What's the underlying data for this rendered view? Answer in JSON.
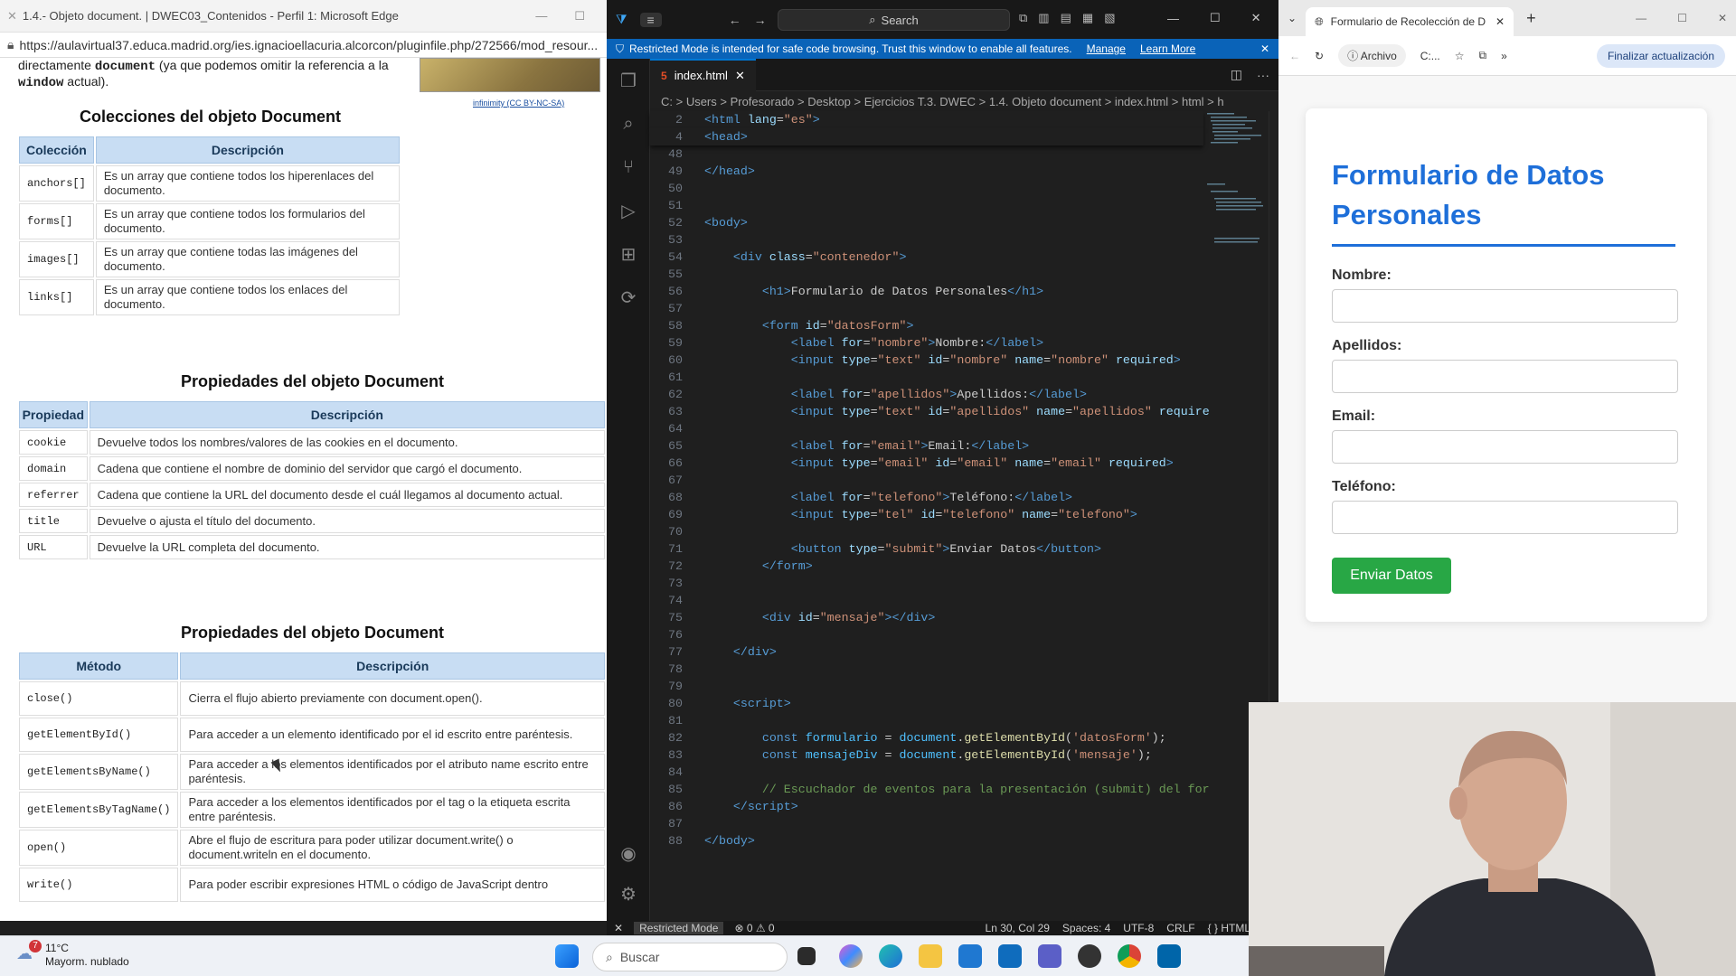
{
  "edge_left": {
    "title": "1.4.- Objeto document. | DWEC03_Contenidos - Perfil 1: Microsoft Edge",
    "url": "https://aulavirtual37.educa.madrid.org/ies.ignacioellacuria.alcorcon/pluginfile.php/272566/mod_resour...",
    "intro_pre": "directamente ",
    "intro_code1": "document",
    "intro_mid": " (ya que podemos omitir la referencia a la ",
    "intro_code2": "window",
    "intro_post": " actual).",
    "image_credit_author": "infinimity",
    "image_credit_license": "(CC BY-NC-SA)",
    "section1_title": "Colecciones del objeto Document",
    "table1": {
      "headers": [
        "Colección",
        "Descripción"
      ],
      "rows": [
        [
          "anchors[]",
          "Es un array que contiene todos los hiperenlaces del documento."
        ],
        [
          "forms[]",
          "Es un array que contiene todos los formularios del documento."
        ],
        [
          "images[]",
          "Es un array que contiene todas las imágenes del documento."
        ],
        [
          "links[]",
          "Es un array que contiene todos los enlaces del documento."
        ]
      ]
    },
    "section2_title": "Propiedades del objeto Document",
    "table2": {
      "headers": [
        "Propiedad",
        "Descripción"
      ],
      "rows": [
        [
          "cookie",
          "Devuelve todos los nombres/valores de las cookies en el documento."
        ],
        [
          "domain",
          "Cadena que contiene el nombre de dominio del servidor que cargó el documento."
        ],
        [
          "referrer",
          "Cadena que contiene la URL del documento desde el cuál llegamos al documento actual."
        ],
        [
          "title",
          "Devuelve o ajusta el título del documento."
        ],
        [
          "URL",
          "Devuelve la URL completa del documento."
        ]
      ]
    },
    "section3_title": "Propiedades del objeto Document",
    "table3": {
      "headers": [
        "Método",
        "Descripción"
      ],
      "rows": [
        [
          "close()",
          "Cierra el flujo abierto previamente con document.open()."
        ],
        [
          "getElementById()",
          "Para acceder a un elemento identificado por el id escrito entre paréntesis."
        ],
        [
          "getElementsByName()",
          "Para acceder a los elementos identificados por el atributo name escrito entre paréntesis."
        ],
        [
          "getElementsByTagName()",
          "Para acceder a los elementos identificados por el tag o la etiqueta escrita entre paréntesis."
        ],
        [
          "open()",
          "Abre el flujo de escritura para poder utilizar document.write() o document.writeln en el documento."
        ],
        [
          "write()",
          "Para poder escribir expresiones HTML o código de JavaScript dentro"
        ]
      ]
    }
  },
  "vscode": {
    "search_placeholder": "Search",
    "restricted_msg": "Restricted Mode is intended for safe code browsing. Trust this window to enable all features.",
    "manage": "Manage",
    "learn_more": "Learn More",
    "tab": "index.html",
    "breadcrumb": "C: > Users > Profesorado > Desktop > Ejercicios T.3. DWEC > 1.4. Objeto document > index.html > html > h",
    "code_lines": [
      {
        "n": "2",
        "h": "<span class=tg>&lt;html</span> <span class=at>lang</span>=<span class=st>\"es\"</span><span class=tg>&gt;</span>",
        "sticky": true
      },
      {
        "n": "4",
        "h": "<span class=tg>&lt;head&gt;</span>",
        "sticky": true
      },
      {
        "n": "48",
        "h": ""
      },
      {
        "n": "49",
        "h": "<span class=tg>&lt;/head&gt;</span>"
      },
      {
        "n": "50",
        "h": ""
      },
      {
        "n": "51",
        "h": ""
      },
      {
        "n": "52",
        "h": "<span class=tg>&lt;body&gt;</span>"
      },
      {
        "n": "53",
        "h": ""
      },
      {
        "n": "54",
        "h": "    <span class=tg>&lt;div</span> <span class=at>class</span>=<span class=st>\"contenedor\"</span><span class=tg>&gt;</span>"
      },
      {
        "n": "55",
        "h": ""
      },
      {
        "n": "56",
        "h": "        <span class=tg>&lt;h1&gt;</span>Formulario de Datos Personales<span class=tg>&lt;/h1&gt;</span>"
      },
      {
        "n": "57",
        "h": ""
      },
      {
        "n": "58",
        "h": "        <span class=tg>&lt;form</span> <span class=at>id</span>=<span class=st>\"datosForm\"</span><span class=tg>&gt;</span>"
      },
      {
        "n": "59",
        "h": "            <span class=tg>&lt;label</span> <span class=at>for</span>=<span class=st>\"nombre\"</span><span class=tg>&gt;</span>Nombre:<span class=tg>&lt;/label&gt;</span>"
      },
      {
        "n": "60",
        "h": "            <span class=tg>&lt;input</span> <span class=at>type</span>=<span class=st>\"text\"</span> <span class=at>id</span>=<span class=st>\"nombre\"</span> <span class=at>name</span>=<span class=st>\"nombre\"</span> <span class=at>required</span><span class=tg>&gt;</span>"
      },
      {
        "n": "61",
        "h": ""
      },
      {
        "n": "62",
        "h": "            <span class=tg>&lt;label</span> <span class=at>for</span>=<span class=st>\"apellidos\"</span><span class=tg>&gt;</span>Apellidos:<span class=tg>&lt;/label&gt;</span>"
      },
      {
        "n": "63",
        "h": "            <span class=tg>&lt;input</span> <span class=at>type</span>=<span class=st>\"text\"</span> <span class=at>id</span>=<span class=st>\"apellidos\"</span> <span class=at>name</span>=<span class=st>\"apellidos\"</span> <span class=at>require</span>"
      },
      {
        "n": "64",
        "h": ""
      },
      {
        "n": "65",
        "h": "            <span class=tg>&lt;label</span> <span class=at>for</span>=<span class=st>\"email\"</span><span class=tg>&gt;</span>Email:<span class=tg>&lt;/label&gt;</span>"
      },
      {
        "n": "66",
        "h": "            <span class=tg>&lt;input</span> <span class=at>type</span>=<span class=st>\"email\"</span> <span class=at>id</span>=<span class=st>\"email\"</span> <span class=at>name</span>=<span class=st>\"email\"</span> <span class=at>required</span><span class=tg>&gt;</span>"
      },
      {
        "n": "67",
        "h": ""
      },
      {
        "n": "68",
        "h": "            <span class=tg>&lt;label</span> <span class=at>for</span>=<span class=st>\"telefono\"</span><span class=tg>&gt;</span>Teléfono:<span class=tg>&lt;/label&gt;</span>"
      },
      {
        "n": "69",
        "h": "            <span class=tg>&lt;input</span> <span class=at>type</span>=<span class=st>\"tel\"</span> <span class=at>id</span>=<span class=st>\"telefono\"</span> <span class=at>name</span>=<span class=st>\"telefono\"</span><span class=tg>&gt;</span>"
      },
      {
        "n": "70",
        "h": ""
      },
      {
        "n": "71",
        "h": "            <span class=tg>&lt;button</span> <span class=at>type</span>=<span class=st>\"submit\"</span><span class=tg>&gt;</span>Enviar Datos<span class=tg>&lt;/button&gt;</span>"
      },
      {
        "n": "72",
        "h": "        <span class=tg>&lt;/form&gt;</span>"
      },
      {
        "n": "73",
        "h": ""
      },
      {
        "n": "74",
        "h": ""
      },
      {
        "n": "75",
        "h": "        <span class=tg>&lt;div</span> <span class=at>id</span>=<span class=st>\"mensaje\"</span><span class=tg>&gt;&lt;/div&gt;</span>"
      },
      {
        "n": "76",
        "h": ""
      },
      {
        "n": "77",
        "h": "    <span class=tg>&lt;/div&gt;</span>"
      },
      {
        "n": "78",
        "h": ""
      },
      {
        "n": "79",
        "h": ""
      },
      {
        "n": "80",
        "h": "    <span class=tg>&lt;script&gt;</span>"
      },
      {
        "n": "81",
        "h": ""
      },
      {
        "n": "82",
        "h": "        <span class=kw>const</span> <span class=vr>formulario</span> = <span class=vr>document</span>.<span class=fn>getElementById</span>(<span class=st>'datosForm'</span>);"
      },
      {
        "n": "83",
        "h": "        <span class=kw>const</span> <span class=vr>mensajeDiv</span> = <span class=vr>document</span>.<span class=fn>getElementById</span>(<span class=st>'mensaje'</span>);"
      },
      {
        "n": "84",
        "h": ""
      },
      {
        "n": "85",
        "h": "        <span class=cm>// Escuchador de eventos para la presentación (submit) del for</span>"
      },
      {
        "n": "86",
        "h": "    <span class=tg>&lt;/script&gt;</span>"
      },
      {
        "n": "87",
        "h": ""
      },
      {
        "n": "88",
        "h": "<span class=tg>&lt;/body&gt;</span>"
      }
    ],
    "status": {
      "mode": "Restricted Mode",
      "problems": "⊗ 0 ⚠ 0",
      "position": "Ln 30, Col 29",
      "spaces": "Spaces: 4",
      "encoding": "UTF-8",
      "eol": "CRLF",
      "language": "{ } HTML"
    }
  },
  "edge_right": {
    "tab_title": "Formulario de Recolección de D",
    "file_pill": "Archivo",
    "path_pill": "C:...",
    "update_btn": "Finalizar actualización",
    "form": {
      "title": "Formulario de Datos Personales",
      "labels": [
        "Nombre:",
        "Apellidos:",
        "Email:",
        "Teléfono:"
      ],
      "button": "Enviar Datos"
    }
  },
  "taskbar": {
    "temp": "11°C",
    "weather": "Mayorm. nublado",
    "badge": "7",
    "search": "Buscar"
  }
}
